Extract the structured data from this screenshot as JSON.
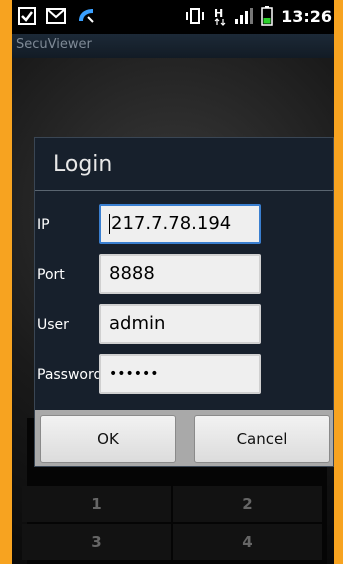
{
  "status_bar": {
    "time": "13:26",
    "network_label": "H"
  },
  "app": {
    "title": "SecuViewer"
  },
  "login": {
    "title": "Login",
    "ip_label": "IP",
    "ip_value": "217.7.78.194",
    "port_label": "Port",
    "port_value": "8888",
    "user_label": "User",
    "user_value": "admin",
    "password_label": "Password",
    "password_value": "••••••",
    "ok_label": "OK",
    "cancel_label": "Cancel"
  },
  "background_keys": [
    "1",
    "2",
    "3",
    "4"
  ],
  "colors": {
    "frame": "#f7a320",
    "dialog_bg": "#17202c",
    "focus_border": "#3a7fd0"
  }
}
